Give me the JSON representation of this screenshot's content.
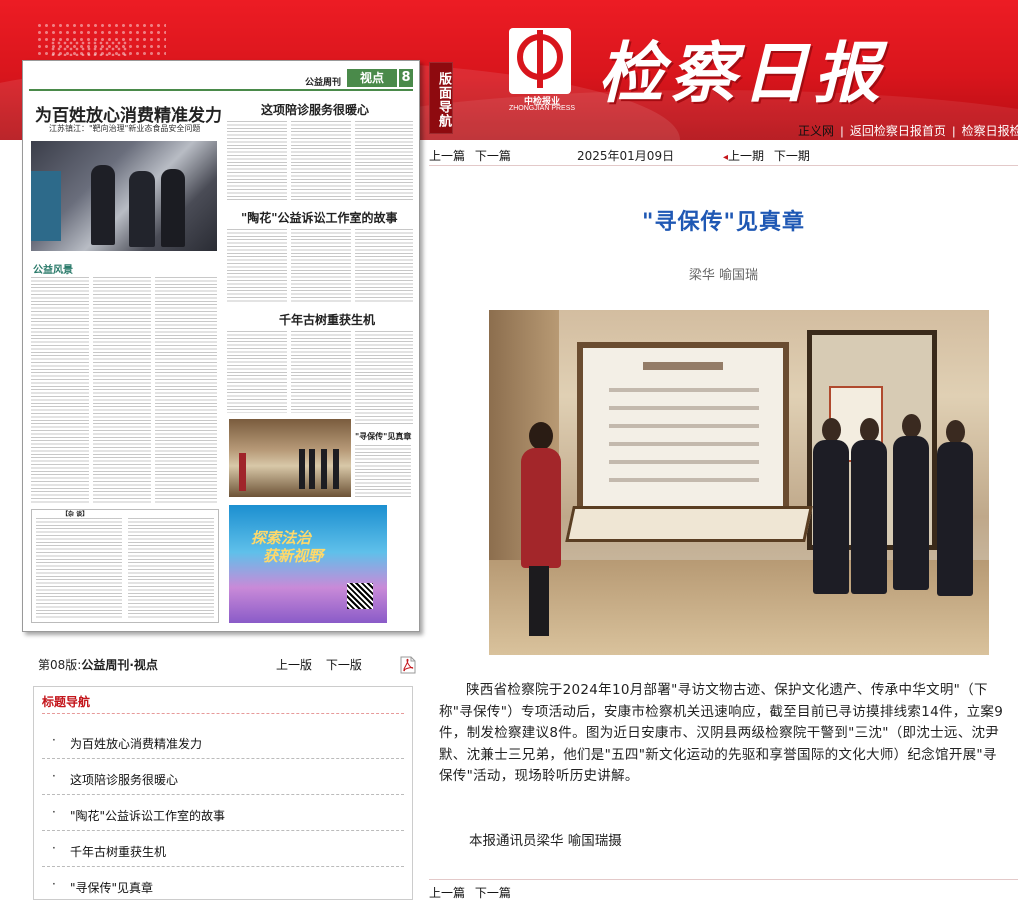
{
  "header": {
    "nav_tag": "版面导航",
    "logo_caption": "中检报业",
    "logo_caption_en": "ZHONGJIAN PRESS",
    "masthead": "检察日报",
    "links": [
      "正义网",
      "返回检察日报首页",
      "检察日报检索"
    ],
    "link_sep": "|"
  },
  "paper_page": {
    "section": "公益周刊",
    "tag": "视点",
    "page_num": "8",
    "headlines": [
      "为百姓放心消费精准发力",
      "江苏镇江：\"靶向治理\"新业态食品安全问题",
      "这项陪诊服务很暖心",
      "\"陶花\"公益诉讼工作室的故事",
      "千年古树重获生机",
      "\"寻保传\"见真章"
    ],
    "column_label": "公益风景",
    "bottom_box_label": "【杂 谈】",
    "ad_line1": "探索法治",
    "ad_line2": "获新视野"
  },
  "page_info": {
    "label": "第08版:",
    "name": "公益周刊·视点",
    "prev": "上一版",
    "next": "下一版",
    "pdf_icon": "pdf-icon"
  },
  "headline_nav": {
    "title": "标题导航",
    "bullet": "·",
    "items": [
      "为百姓放心消费精准发力",
      "这项陪诊服务很暖心",
      "\"陶花\"公益诉讼工作室的故事",
      "千年古树重获生机",
      "\"寻保传\"见真章"
    ]
  },
  "article_nav": {
    "prev_article": "上一篇",
    "next_article": "下一篇",
    "date": "2025年01月09日",
    "prev_issue": "上一期",
    "next_issue": "下一期",
    "arrow": "◂"
  },
  "article": {
    "title": "\"寻保传\"见真章",
    "author": "梁华  喻国瑞",
    "body": "陕西省检察院于2024年10月部署\"寻访文物古迹、保护文化遗产、传承中华文明\"（下称\"寻保传\"）专项活动后，安康市检察机关迅速响应，截至目前已寻访摸排线索14件，立案9件，制发检察建议8件。图为近日安康市、汉阴县两级检察院干警到\"三沈\"（即沈士远、沈尹默、沈兼士三兄弟，他们是\"五四\"新文化运动的先驱和享誉国际的文化大师）纪念馆开展\"寻保传\"活动，现场聆听历史讲解。",
    "credit": "本报通讯员梁华  喻国瑞摄"
  },
  "colors": {
    "brand_red": "#d8151c",
    "title_blue": "#1f58b4",
    "nav_red": "#c4161c",
    "section_green": "#4a8a4a"
  }
}
